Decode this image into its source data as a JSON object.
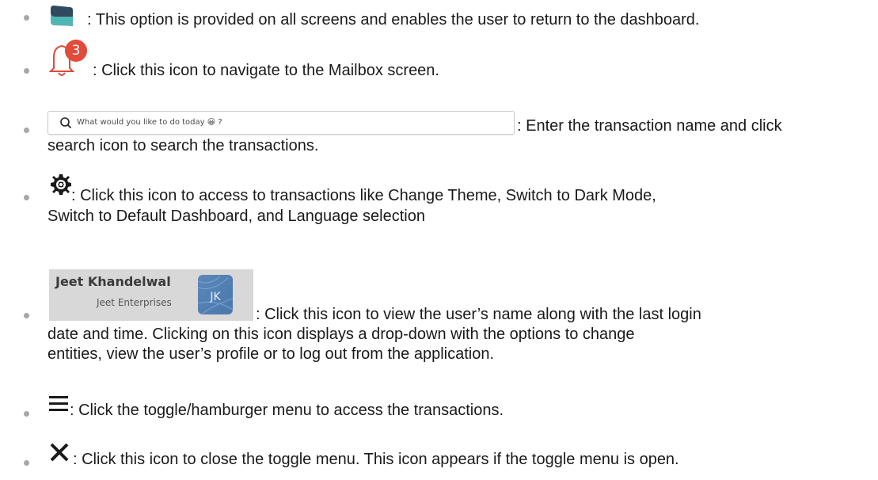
{
  "items": [
    {
      "icon": "dashboard-icon",
      "text": ": This option is provided on all screens and enables the user to return to the dashboard."
    },
    {
      "icon": "bell-icon",
      "badge": "3",
      "text": ": Click this icon to navigate to the Mailbox screen."
    },
    {
      "icon": "search-bar",
      "placeholder": "What would you like to do today 😀 ?",
      "text": ": Enter the transaction name and click",
      "text2": "search icon to search the transactions."
    },
    {
      "icon": "gear-icon",
      "text": ": Click this icon to access to transactions like Change Theme, Switch to Dark Mode,",
      "text2": "Switch to Default Dashboard, and Language selection"
    },
    {
      "icon": "user-card",
      "user_name": "Jeet Khandelwal",
      "entity": "Jeet Enterprises",
      "initials": "JK",
      "text": ": Click this icon to view  the user’s name along with the last login",
      "text2": "date and time. Clicking on this icon displays a drop-down with the options to change",
      "text3": "entities, view the user’s profile or to log out from the application."
    },
    {
      "icon": "hamburger-icon",
      "text": ": Click the toggle/hamburger menu to access the transactions."
    },
    {
      "icon": "close-icon",
      "text": ": Click this icon to close the toggle menu. This icon appears if the toggle menu is open."
    }
  ],
  "colors": {
    "text": "#1a1a1a",
    "bullet": "#a7a7a7",
    "badge": "#e04b3a",
    "dashboard_teal": "#4fb7b3",
    "dashboard_dark": "#2f4a5e"
  }
}
